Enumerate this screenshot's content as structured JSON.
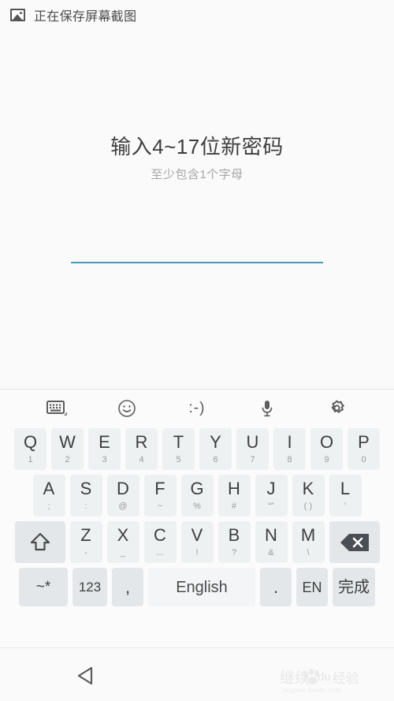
{
  "status_bar": {
    "icon": "image-icon",
    "text": "正在保存屏幕截图"
  },
  "content": {
    "title": "输入4~17位新密码",
    "subtitle": "至少包含1个字母",
    "password_field": {
      "value": "",
      "placeholder": ""
    },
    "accent_color": "#4a9ab5"
  },
  "keyboard": {
    "toolbar": [
      {
        "name": "keyboard-layout-icon",
        "label": ""
      },
      {
        "name": "emoji-icon",
        "label": ""
      },
      {
        "name": "emoticon-icon",
        "label": ":-)"
      },
      {
        "name": "microphone-icon",
        "label": ""
      },
      {
        "name": "settings-gear-icon",
        "label": ""
      }
    ],
    "row1": [
      {
        "main": "Q",
        "sub": "1"
      },
      {
        "main": "W",
        "sub": "2"
      },
      {
        "main": "E",
        "sub": "3"
      },
      {
        "main": "R",
        "sub": "4"
      },
      {
        "main": "T",
        "sub": "5"
      },
      {
        "main": "Y",
        "sub": "6"
      },
      {
        "main": "U",
        "sub": "7"
      },
      {
        "main": "I",
        "sub": "8"
      },
      {
        "main": "O",
        "sub": "9"
      },
      {
        "main": "P",
        "sub": "0"
      }
    ],
    "row2": [
      {
        "main": "A",
        "sub": ";"
      },
      {
        "main": "S",
        "sub": ":"
      },
      {
        "main": "D",
        "sub": "@"
      },
      {
        "main": "F",
        "sub": "~"
      },
      {
        "main": "G",
        "sub": "%"
      },
      {
        "main": "H",
        "sub": "#"
      },
      {
        "main": "J",
        "sub": "“”"
      },
      {
        "main": "K",
        "sub": "( )"
      },
      {
        "main": "L",
        "sub": "’"
      }
    ],
    "row3": {
      "shift_label": "",
      "keys": [
        {
          "main": "Z",
          "sub": "-"
        },
        {
          "main": "X",
          "sub": "_"
        },
        {
          "main": "C",
          "sub": "..."
        },
        {
          "main": "V",
          "sub": "!"
        },
        {
          "main": "B",
          "sub": "?"
        },
        {
          "main": "N",
          "sub": "&"
        },
        {
          "main": "M",
          "sub": "\\"
        }
      ],
      "backspace_label": ""
    },
    "row4": {
      "symbols": "~*",
      "numbers": "123",
      "comma": ",",
      "space": "English",
      "period": ".",
      "language": "EN",
      "done": "完成"
    }
  },
  "nav_bar": {
    "back_label": "back-button"
  },
  "watermark": {
    "text": "继续",
    "brand": "du",
    "suffix": "经验",
    "url": "jingyan.baidu.com"
  }
}
